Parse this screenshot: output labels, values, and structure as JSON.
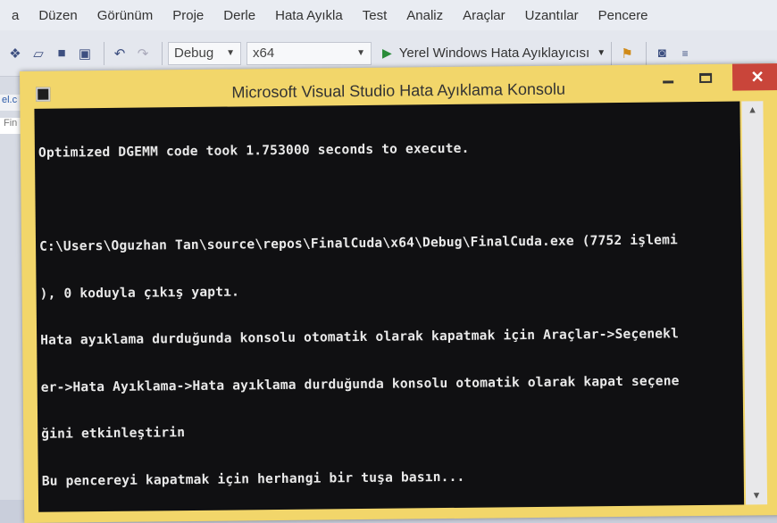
{
  "ide": {
    "menu": [
      "a",
      "Düzen",
      "Görünüm",
      "Proje",
      "Derle",
      "Hata Ayıkla",
      "Test",
      "Analiz",
      "Araçlar",
      "Uzantılar",
      "Pencere"
    ],
    "toolbar": {
      "config": "Debug",
      "platform": "x64",
      "run_label": "Yerel Windows Hata Ayıklayıcısı"
    },
    "left_tab_1": "el.c",
    "left_tab_2": "Fin"
  },
  "console": {
    "title": "Microsoft Visual Studio Hata Ayıklama Konsolu",
    "close_glyph": "✕",
    "lines": [
      "Optimized DGEMM code took 1.753000 seconds to execute.",
      "",
      "C:\\Users\\Oguzhan Tan\\source\\repos\\FinalCuda\\x64\\Debug\\FinalCuda.exe (7752 işlemi",
      "), 0 koduyla çıkış yaptı.",
      "Hata ayıklama durduğunda konsolu otomatik olarak kapatmak için Araçlar->Seçenekl",
      "er->Hata Ayıklama->Hata ayıklama durduğunda konsolu otomatik olarak kapat seçene",
      "ğini etkinleştirin",
      "Bu pencereyi kapatmak için herhangi bir tuşa basın..."
    ]
  },
  "colors": {
    "console_bg": "#101012",
    "console_text": "#e9e9e9",
    "window_frame": "#f2d66a",
    "close_button": "#c9453a",
    "ide_accent": "#3f5aa6"
  }
}
